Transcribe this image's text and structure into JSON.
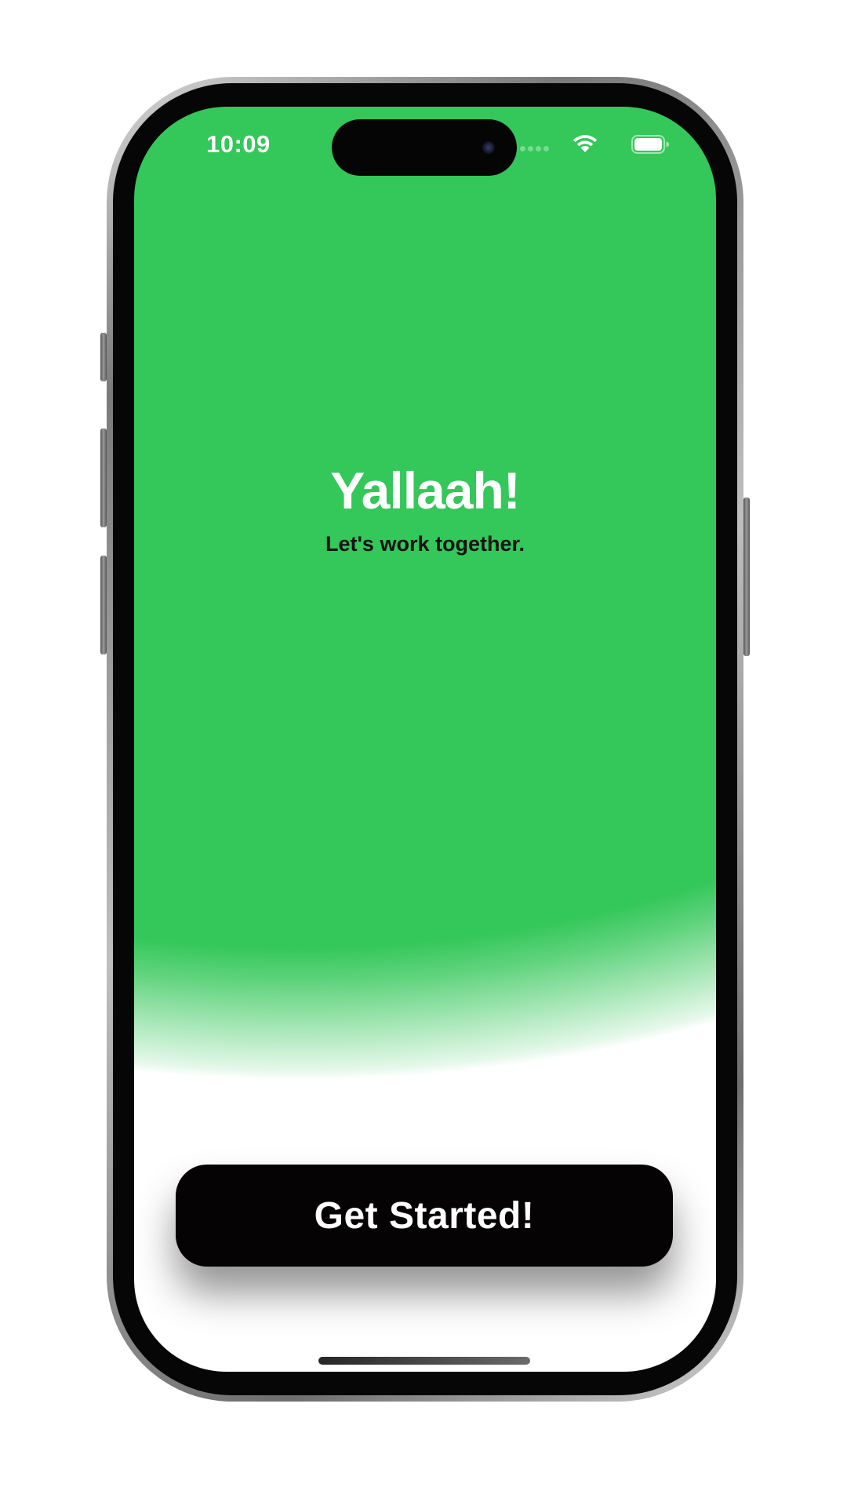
{
  "status_bar": {
    "time": "10:09",
    "icons": [
      "signal-dots-icon",
      "wifi-icon",
      "battery-icon"
    ]
  },
  "hero": {
    "title": "Yallaah!",
    "subtitle": "Let's work together."
  },
  "cta": {
    "label": "Get Started!"
  },
  "colors": {
    "brand_green": "#34c759",
    "button_background": "#050303",
    "title_text": "#ffffff",
    "subtitle_text": "#111111"
  }
}
